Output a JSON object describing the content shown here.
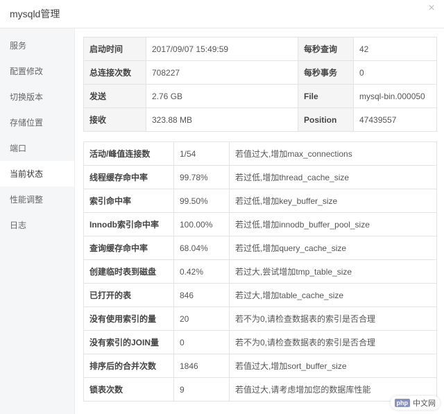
{
  "title": "mysqld管理",
  "sidebar": {
    "items": [
      {
        "label": "服务"
      },
      {
        "label": "配置修改"
      },
      {
        "label": "切换版本"
      },
      {
        "label": "存储位置"
      },
      {
        "label": "端口"
      },
      {
        "label": "当前状态"
      },
      {
        "label": "性能调整"
      },
      {
        "label": "日志"
      }
    ],
    "active_index": 5
  },
  "summary": {
    "rows": [
      {
        "k1": "启动时间",
        "v1": "2017/09/07 15:49:59",
        "k2": "每秒查询",
        "v2": "42"
      },
      {
        "k1": "总连接次数",
        "v1": "708227",
        "k2": "每秒事务",
        "v2": "0"
      },
      {
        "k1": "发送",
        "v1": "2.76 GB",
        "k2": "File",
        "v2": "mysql-bin.000050"
      },
      {
        "k1": "接收",
        "v1": "323.88 MB",
        "k2": "Position",
        "v2": "47439557"
      }
    ]
  },
  "metrics": [
    {
      "label": "活动/峰值连接数",
      "value": "1/54",
      "hint": "若值过大,增加max_connections"
    },
    {
      "label": "线程缓存命中率",
      "value": "99.78%",
      "hint": "若过低,增加thread_cache_size"
    },
    {
      "label": "索引命中率",
      "value": "99.50%",
      "hint": "若过低,增加key_buffer_size"
    },
    {
      "label": "Innodb索引命中率",
      "value": "100.00%",
      "hint": "若过低,增加innodb_buffer_pool_size"
    },
    {
      "label": "查询缓存命中率",
      "value": "68.04%",
      "hint": "若过低,增加query_cache_size"
    },
    {
      "label": "创建临时表到磁盘",
      "value": "0.42%",
      "hint": "若过大,尝试增加tmp_table_size"
    },
    {
      "label": "已打开的表",
      "value": "846",
      "hint": "若过大,增加table_cache_size"
    },
    {
      "label": "没有使用索引的量",
      "value": "20",
      "hint": "若不为0,请检查数据表的索引是否合理"
    },
    {
      "label": "没有索引的JOIN量",
      "value": "0",
      "hint": "若不为0,请检查数据表的索引是否合理"
    },
    {
      "label": "排序后的合并次数",
      "value": "1846",
      "hint": "若值过大,增加sort_buffer_size"
    },
    {
      "label": "锁表次数",
      "value": "9",
      "hint": "若值过大,请考虑增加您的数据库性能"
    }
  ],
  "footer": {
    "logo": "php",
    "text": "中文网"
  }
}
